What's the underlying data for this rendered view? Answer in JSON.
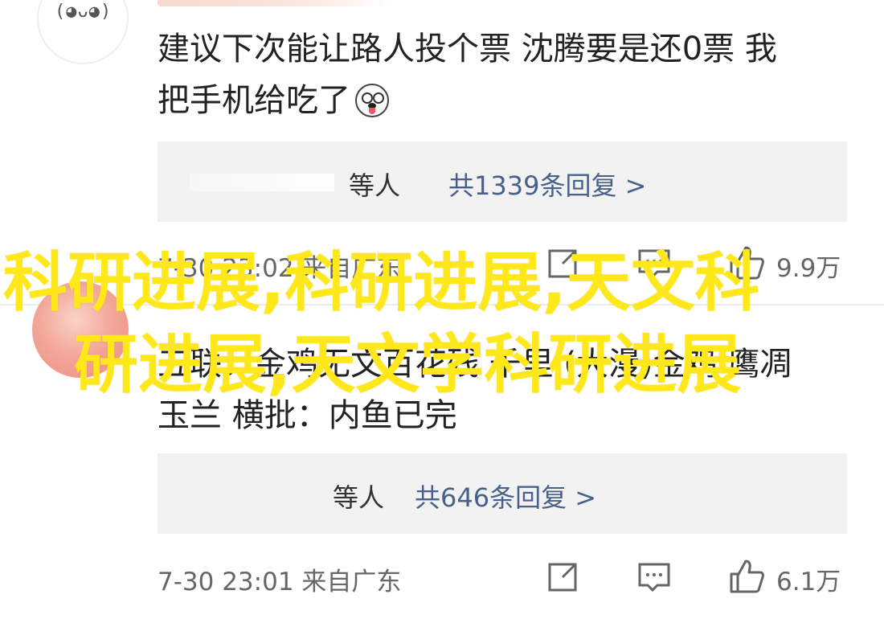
{
  "comment1": {
    "line1": "建议下次能让路人投个票 沈腾要是还0票 我",
    "line2": "把手机给吃了",
    "emoji_icon": "dog-face-emoji-icon",
    "reply_summary": {
      "prefix": "等人",
      "link": "共1339条回复 >"
    },
    "meta": {
      "date": "7-30 23:02 来自广东",
      "likes": "9.9万"
    }
  },
  "comment2": {
    "line1": "五联：金鸡无文百花残 千里 (大漫)金鸡 鹰凋",
    "line2": "玉兰 横批：内鱼已完",
    "reply_summary": {
      "prefix": "等人",
      "link": "共646条回复 >"
    },
    "meta": {
      "date": "7-30 23:01 来自广东",
      "likes": "6.1万"
    }
  },
  "watermark": {
    "line1": "科研进展,科研进展,天文科",
    "line2": "研进展,天文学科研进展"
  },
  "icons": [
    "share-icon",
    "comment-icon",
    "like-icon"
  ],
  "colors": {
    "link": "#48618a",
    "watermark": "#ffe81a",
    "reply_bg": "#f2f2f2"
  }
}
